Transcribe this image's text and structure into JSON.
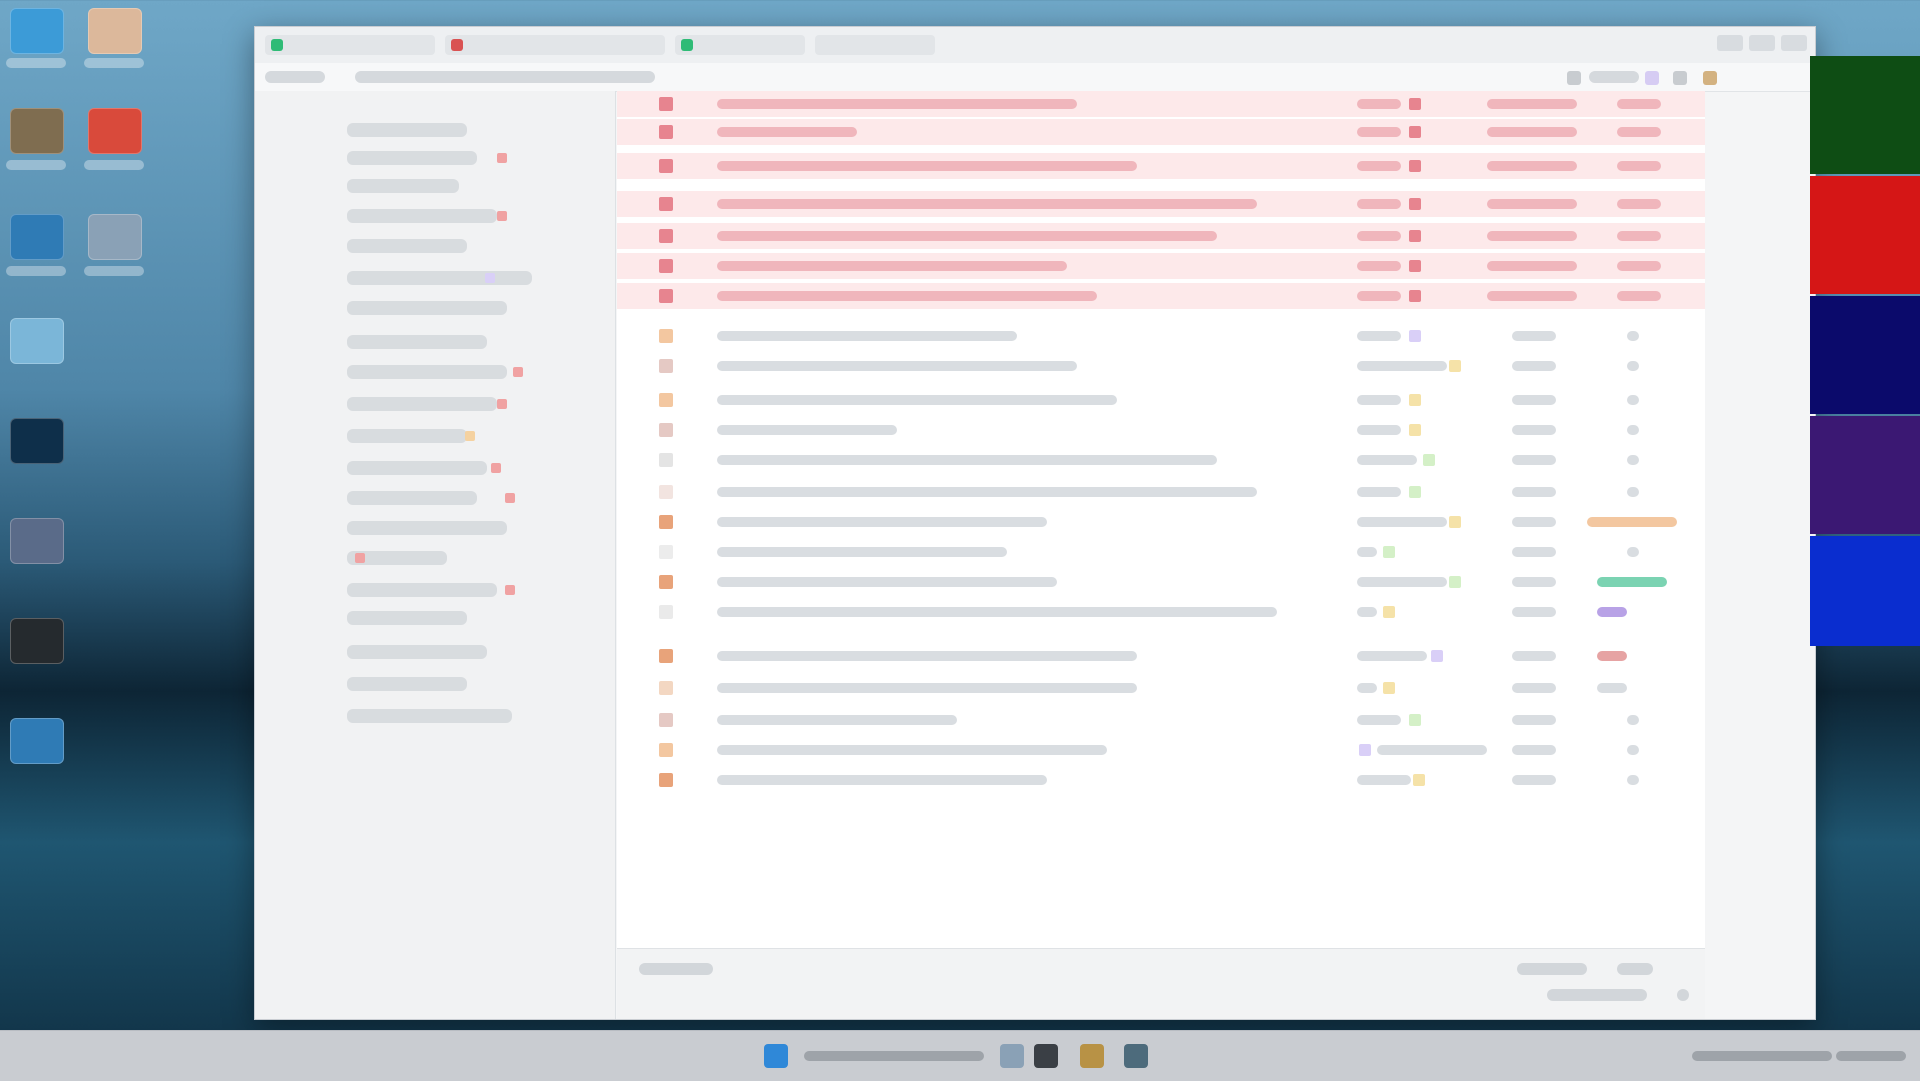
{
  "theme": {
    "accent": "#2f88d8",
    "flag_row": "#fde9ea",
    "flag_text": "#e7848f",
    "tag_colors": [
      "#f3c7a0",
      "#d4f0c7",
      "#f5e2a8",
      "#d9cff7",
      "#7bd3b2",
      "#e6a3a3",
      "#b57b6f"
    ]
  },
  "desktop": {
    "icons": [
      {
        "name": "folder-icon",
        "color": "#3c9bd7"
      },
      {
        "name": "app-icon",
        "color": "#dcb89b"
      },
      {
        "name": "photo-icon",
        "color": "#7f6d50"
      },
      {
        "name": "chrome-icon",
        "color": "#d94a3b"
      },
      {
        "name": "document-icon",
        "color": "#2f7bb5"
      },
      {
        "name": "settings-icon",
        "color": "#8aa1b6"
      },
      {
        "name": "game-icon",
        "color": "#7bb6d8"
      },
      {
        "name": "terminal-icon",
        "color": "#0e2f4a"
      },
      {
        "name": "media-icon",
        "color": "#5a6b89"
      },
      {
        "name": "camera-icon",
        "color": "#252a2e"
      },
      {
        "name": "network-icon",
        "color": "#2f7bb5"
      }
    ]
  },
  "window": {
    "tabs": [
      {
        "name": "tab-mail",
        "dot": "#2fbb76"
      },
      {
        "name": "tab-calendar",
        "dot": "#d95252"
      },
      {
        "name": "tab-contacts",
        "dot": "#2fbb76"
      },
      {
        "name": "tab-tasks",
        "dot": ""
      }
    ]
  },
  "sidebar": {
    "folders": [
      {
        "name": "inbox-folder",
        "mark": ""
      },
      {
        "name": "drafts-folder",
        "mark": "#f0a2a2"
      },
      {
        "name": "sent-folder",
        "mark": ""
      },
      {
        "name": "spam-folder",
        "mark": "#f0a2a2"
      },
      {
        "name": "archive-folder",
        "mark": ""
      },
      {
        "name": "projects-folder",
        "mark": "#d9cff7"
      },
      {
        "name": "family-folder",
        "mark": ""
      },
      {
        "name": "finance-folder",
        "mark": "#f0a2a2"
      },
      {
        "name": "work-folder",
        "mark": "#f0a2a2"
      },
      {
        "name": "travel-folder",
        "mark": "#f0a2a2"
      },
      {
        "name": "notes-folder",
        "mark": "#f5d2a0"
      },
      {
        "name": "receipts-folder",
        "mark": "#f0a2a2"
      },
      {
        "name": "shared-folder",
        "mark": "#f0a2a2"
      },
      {
        "name": "updates-folder",
        "mark": ""
      },
      {
        "name": "social-folder",
        "mark": "#f0a2a2"
      },
      {
        "name": "forums-folder",
        "mark": "#f0a2a2"
      }
    ]
  },
  "messages": {
    "rows": [
      {
        "flagged": true,
        "tag": "#e7848f",
        "attach": false
      },
      {
        "flagged": true,
        "tag": "#e7848f",
        "attach": false
      },
      {
        "flagged": true,
        "tag": "#e7848f",
        "attach": false
      },
      {
        "flagged": true,
        "tag": "#e7848f",
        "attach": false
      },
      {
        "flagged": true,
        "tag": "#e7848f",
        "attach": false
      },
      {
        "flagged": true,
        "tag": "#e7848f",
        "attach": false
      },
      {
        "flagged": true,
        "tag": "#e7848f",
        "attach": false
      },
      {
        "flagged": false,
        "tag": "#d9cff7",
        "attach": false
      },
      {
        "flagged": false,
        "tag": "#f5e2a8",
        "attach": false
      },
      {
        "flagged": false,
        "tag": "#f5e2a8",
        "attach": false
      },
      {
        "flagged": false,
        "tag": "#f5e2a8",
        "attach": false
      },
      {
        "flagged": false,
        "tag": "#d4f0c7",
        "attach": false
      },
      {
        "flagged": false,
        "tag": "#d4f0c7",
        "attach": false
      },
      {
        "flagged": false,
        "tag": "#f5e2a8",
        "attach": true
      },
      {
        "flagged": false,
        "tag": "#d4f0c7",
        "attach": false
      },
      {
        "flagged": false,
        "tag": "#d4f0c7",
        "attach": true
      },
      {
        "flagged": false,
        "tag": "#f5e2a8",
        "attach": true
      },
      {
        "flagged": false,
        "tag": "#d9cff7",
        "attach": false
      },
      {
        "flagged": false,
        "tag": "#f5e2a8",
        "attach": true
      },
      {
        "flagged": false,
        "tag": "#d4f0c7",
        "attach": false
      },
      {
        "flagged": false,
        "tag": "#d9cff7",
        "attach": false
      },
      {
        "flagged": false,
        "tag": "#f5e2a8",
        "attach": false
      }
    ]
  },
  "right_strip": {
    "colors": [
      "#0e4d14",
      "#d51616",
      "#0b0a6b",
      "#3b1873",
      "#0a2dcf"
    ]
  },
  "taskbar": {
    "icons": [
      {
        "name": "start-icon",
        "color": "#2f88d8"
      },
      {
        "name": "explorer-icon",
        "color": "#8aa1b6"
      },
      {
        "name": "media-player-icon",
        "color": "#3a3f45"
      },
      {
        "name": "file-manager-icon",
        "color": "#b89245"
      },
      {
        "name": "terminal-icon",
        "color": "#4d6b7c"
      }
    ]
  }
}
